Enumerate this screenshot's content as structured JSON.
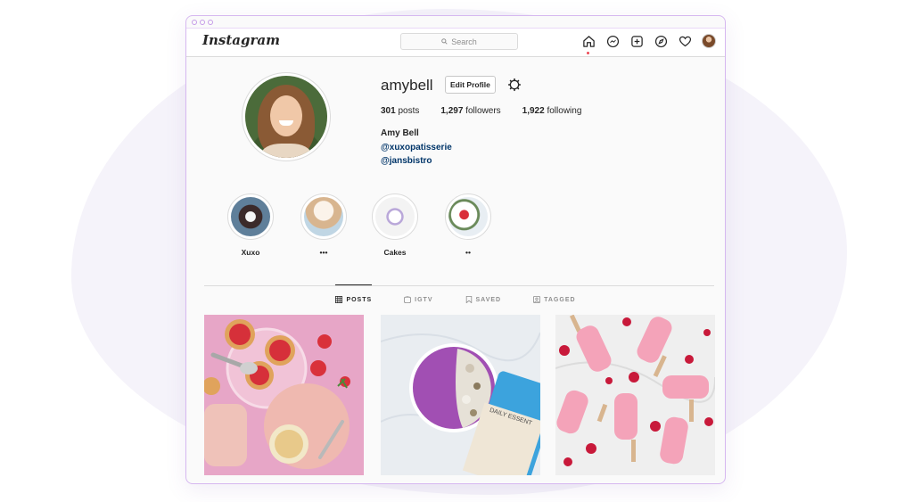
{
  "app": {
    "logo_text": "Instagram"
  },
  "search": {
    "placeholder": "Search"
  },
  "colors": {
    "link": "#003569",
    "window_border": "#d6b8f0",
    "notification_dot": "#ed4956"
  },
  "nav": {
    "icons": [
      "home-icon",
      "messenger-icon",
      "new-post-icon",
      "explore-icon",
      "activity-heart-icon",
      "profile-avatar"
    ]
  },
  "profile": {
    "username": "amybell",
    "edit_profile_label": "Edit Profile",
    "stats": {
      "posts": "301",
      "posts_label": "posts",
      "followers": "1,297",
      "followers_label": "followers",
      "following": "1,922",
      "following_label": "following"
    },
    "full_name": "Amy Bell",
    "bio_links": [
      "@xuxopatisserie",
      "@jansbistro"
    ]
  },
  "highlights": [
    {
      "label": "Xuxo"
    },
    {
      "label": "•••"
    },
    {
      "label": "Cakes"
    },
    {
      "label": "••"
    }
  ],
  "tabs": [
    {
      "label": "POSTS",
      "icon": "grid-icon",
      "active": true
    },
    {
      "label": "IGTV",
      "icon": "igtv-icon",
      "active": false
    },
    {
      "label": "SAVED",
      "icon": "bookmark-icon",
      "active": false
    },
    {
      "label": "TAGGED",
      "icon": "tagged-icon",
      "active": false
    }
  ],
  "posts": [
    {
      "subject": "strawberry-tarts-tea"
    },
    {
      "subject": "acai-bowl-supplement",
      "package_text": "DAILY ESSENT"
    },
    {
      "subject": "raspberry-popsicles"
    }
  ]
}
